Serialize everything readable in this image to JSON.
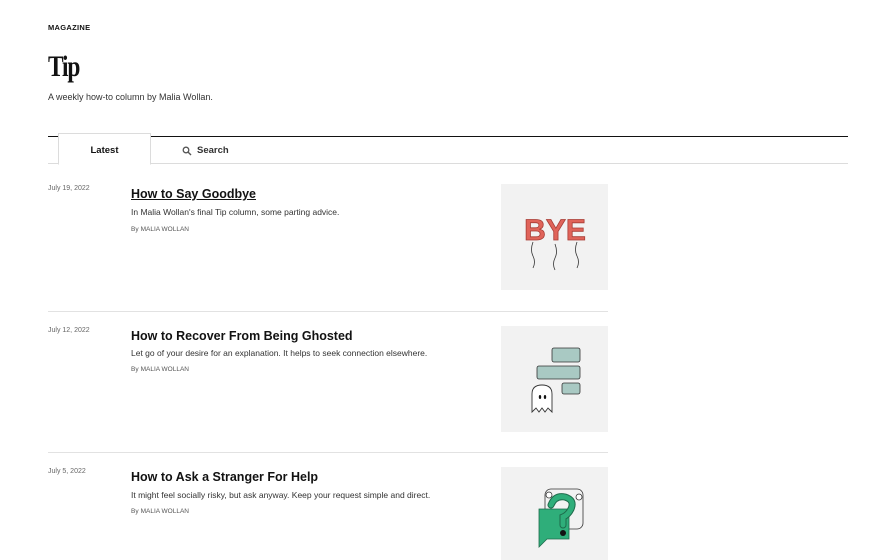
{
  "header": {
    "section_label": "MAGAZINE",
    "title": "Tip",
    "subtitle": "A weekly how-to column by Malia Wollan."
  },
  "tabs": {
    "latest": "Latest",
    "search": "Search"
  },
  "byline_prefix": "By",
  "articles": [
    {
      "date": "July 19, 2022",
      "title": "How to Say Goodbye",
      "summary": "In Malia Wollan's final Tip column, some parting advice.",
      "author": "MALIA WOLLAN",
      "image": "bye-balloons-illustration",
      "image_text": "BYE"
    },
    {
      "date": "July 12, 2022",
      "title": "How to Recover From Being Ghosted",
      "summary": "Let go of your desire for an explanation. It helps to seek connection elsewhere.",
      "author": "MALIA WOLLAN",
      "image": "ghost-chat-bubbles-illustration"
    },
    {
      "date": "July 5, 2022",
      "title": "How to Ask a Stranger For Help",
      "summary": "It might feel socially risky, but ask anyway. Keep your request simple and direct.",
      "author": "MALIA WOLLAN",
      "image": "question-mark-bubble-illustration"
    }
  ],
  "colors": {
    "balloon_red": "#e0645a",
    "chat_bubble": "#a9c9c3",
    "accent_green": "#2fae7a"
  }
}
